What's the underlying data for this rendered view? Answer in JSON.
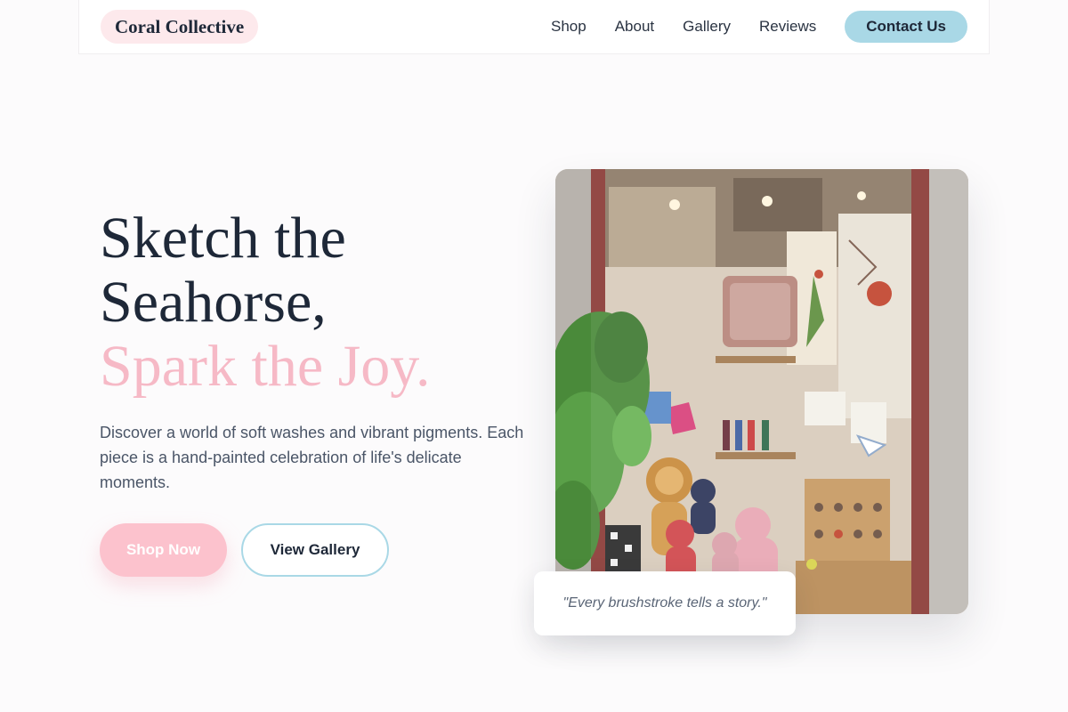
{
  "header": {
    "logo": "Coral Collective",
    "nav": [
      {
        "label": "Shop"
      },
      {
        "label": "About"
      },
      {
        "label": "Gallery"
      },
      {
        "label": "Reviews"
      }
    ],
    "contact_label": "Contact Us"
  },
  "hero": {
    "title_line1": "Sketch the",
    "title_line2": "Seahorse,",
    "title_accent": "Spark the Joy.",
    "description": "Discover a world of soft washes and vibrant pigments. Each piece is a hand-painted celebration of life's delicate moments.",
    "primary_button": "Shop Now",
    "secondary_button": "View Gallery",
    "image_alt": "Shop window display with plush toys, cushions, bird illustrations and hanging plants",
    "quote": "\"Every brushstroke tells a story.\""
  },
  "colors": {
    "accent_pink": "#f6b9c6",
    "accent_blue": "#a9d8e6",
    "text_dark": "#1e2838"
  }
}
